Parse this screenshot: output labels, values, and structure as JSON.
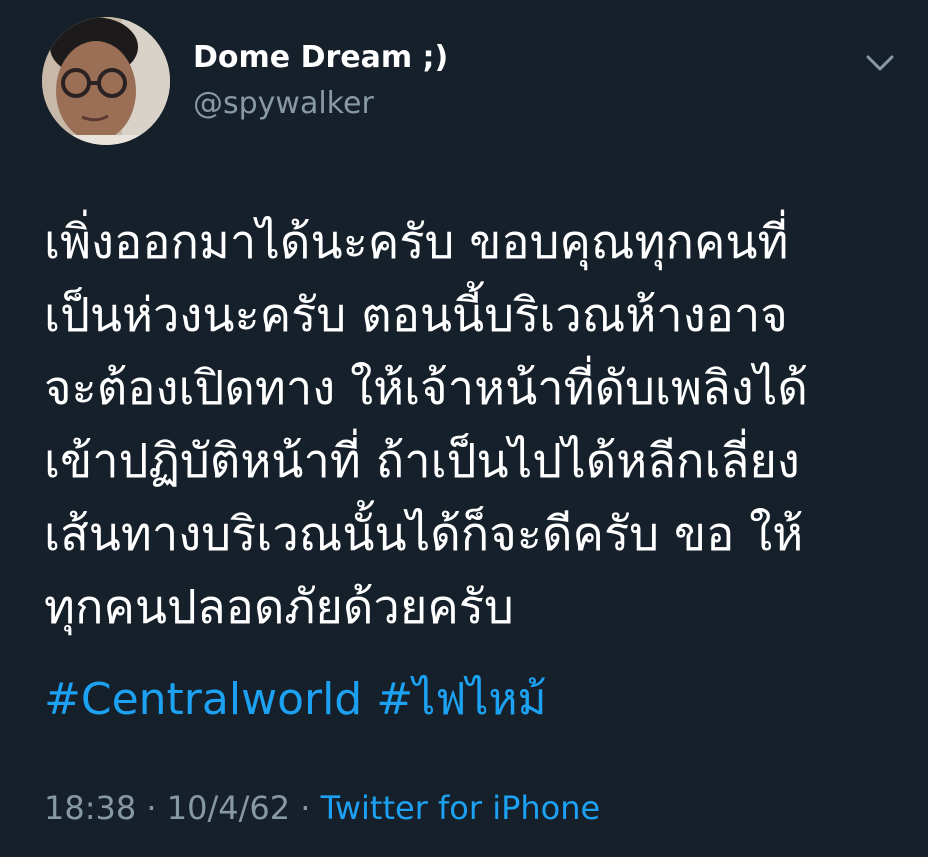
{
  "tweet": {
    "author": {
      "display_name": "Dome Dream ;)",
      "handle": "@spywalker",
      "avatar_icon": "avatar-photo"
    },
    "menu_icon": "chevron-down-icon",
    "text_lines": [
      "เพิ่งออกมาได้นะครับ ขอบคุณทุกคนที่",
      "เป็นห่วงนะครับ ตอนนี้บริเวณห้างอาจ",
      "จะต้องเปิดทาง ให้เจ้าหน้าที่ดับเพลิงได้",
      "เข้าปฏิบัติหน้าที่ ถ้าเป็นไปได้หลีกเลี่ยง",
      "เส้นทางบริเวณนั้นได้ก็จะดีครับ ขอ ให้",
      "ทุกคนปลอดภัยด้วยครับ"
    ],
    "hashtags": [
      "#Centralworld",
      "#ไฟไหม้"
    ],
    "time": "18:38",
    "separator": "·",
    "date": "10/4/62",
    "source": "Twitter for iPhone"
  },
  "colors": {
    "background": "#15202b",
    "primary_text": "#ffffff",
    "secondary_text": "#8899a6",
    "link": "#1da1f2"
  }
}
